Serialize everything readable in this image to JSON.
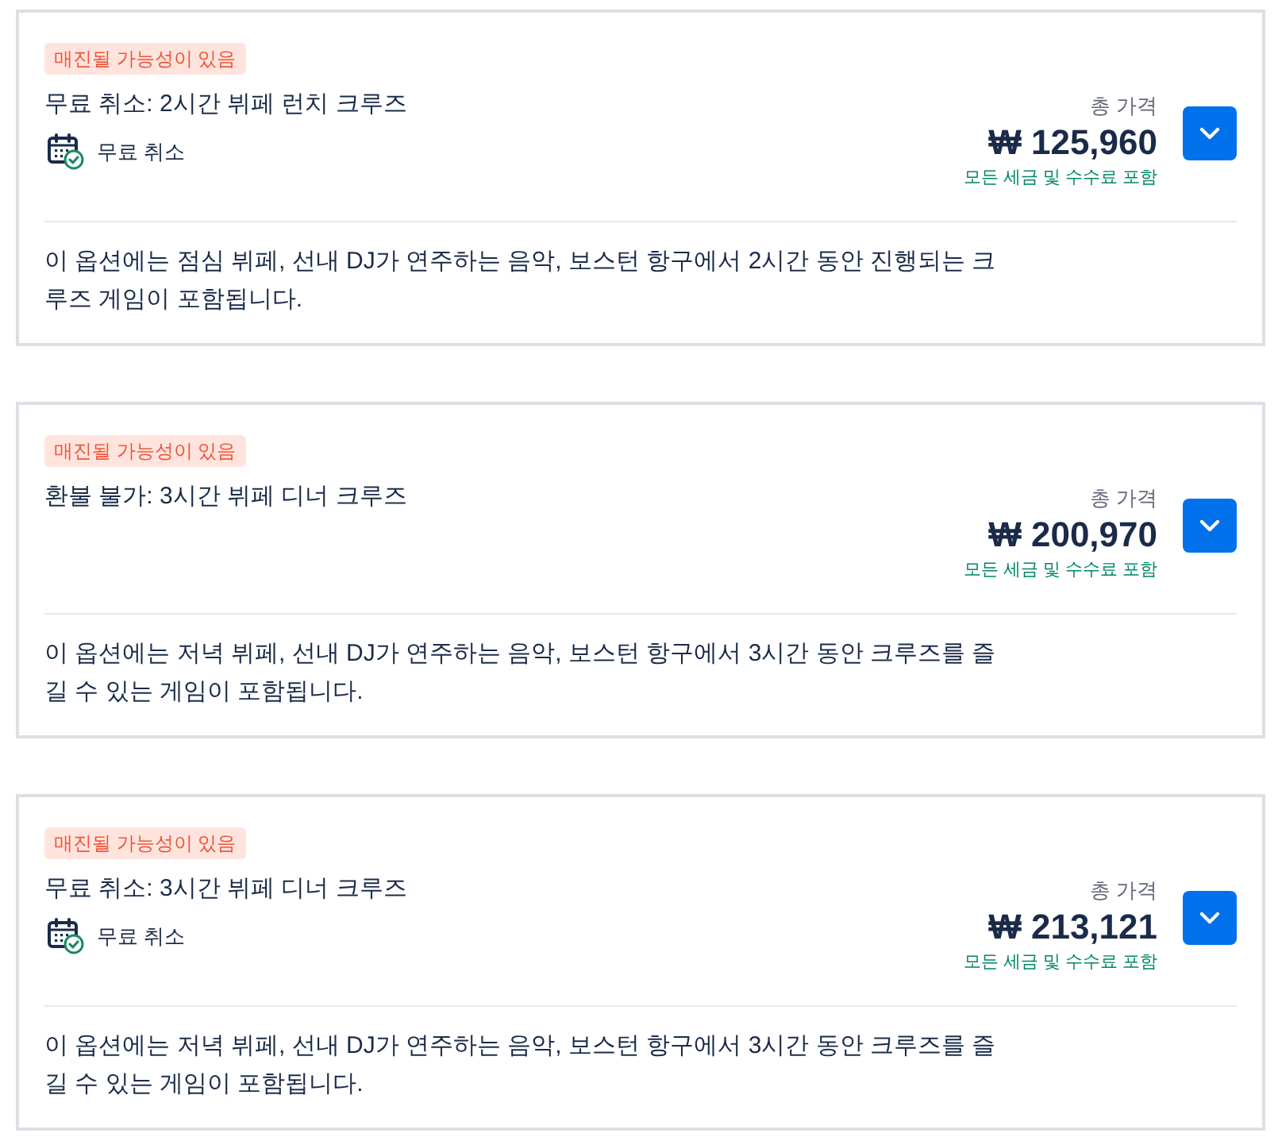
{
  "options": [
    {
      "badge": "매진될 가능성이 있음",
      "title": "무료 취소: 2시간 뷔페 런치 크루즈",
      "cancellation": "무료 취소",
      "price_label": "총 가격",
      "price": "₩ 125,960",
      "price_note": "모든 세금 및 수수료 포함",
      "expanded": false,
      "description": "이 옵션에는 점심 뷔페, 선내 DJ가 연주하는 음악, 보스턴 항구에서 2시간 동안 진행되는 크루즈 게임이 포함됩니다."
    },
    {
      "badge": "매진될 가능성이 있음",
      "title": "환불 불가: 3시간 뷔페 디너 크루즈",
      "price_label": "총 가격",
      "price": "₩ 200,970",
      "price_note": "모든 세금 및 수수료 포함",
      "expanded": false,
      "description": "이 옵션에는 저녁 뷔페, 선내 DJ가 연주하는 음악, 보스턴 항구에서 3시간 동안 크루즈를 즐길 수 있는 게임이 포함됩니다."
    },
    {
      "badge": "매진될 가능성이 있음",
      "title": "무료 취소: 3시간 뷔페 디너 크루즈",
      "cancellation": "무료 취소",
      "price_label": "총 가격",
      "price": "₩ 213,121",
      "price_note": "모든 세금 및 수수료 포함",
      "expanded": false,
      "description": "이 옵션에는 저녁 뷔페, 선내 DJ가 연주하는 음악, 보스턴 항구에서 3시간 동안 크루즈를 즐길 수 있는 게임이 포함됩니다."
    }
  ]
}
